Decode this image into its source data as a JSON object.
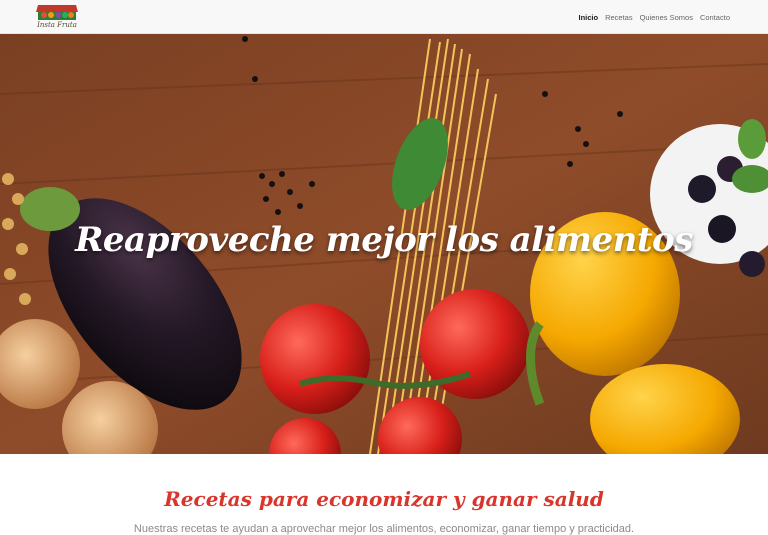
{
  "header": {
    "logo_text": "Insta Fruta",
    "nav": [
      {
        "label": "Inicio",
        "active": true
      },
      {
        "label": "Recetas",
        "active": false
      },
      {
        "label": "Quienes Somos",
        "active": false
      },
      {
        "label": "Contacto",
        "active": false
      }
    ]
  },
  "hero": {
    "title": "Reaproveche mejor los alimentos"
  },
  "content": {
    "section_title": "Recetas para economizar y ganar salud",
    "description": "Nuestras recetas te ayudan a aprovechar mejor los alimentos, economizar, ganar tiempo y practicidad."
  },
  "colors": {
    "accent": "#d9352c",
    "navbar_bg": "#f8f8f8"
  }
}
